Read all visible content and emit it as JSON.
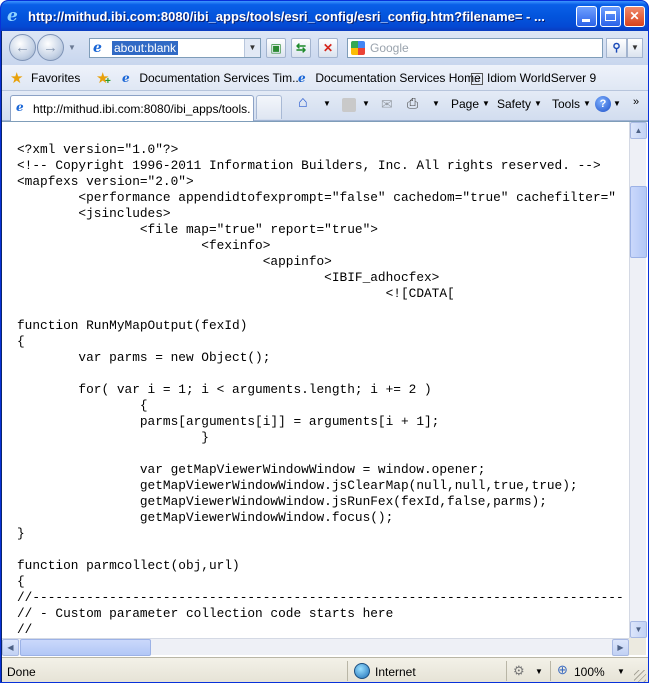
{
  "window": {
    "title": "http://mithud.ibi.com:8080/ibi_apps/tools/esri_config/esri_config.htm?filename= - ..."
  },
  "toolbar": {
    "address_value": "about:blank",
    "search_placeholder": "Google"
  },
  "favorites": {
    "label": "Favorites",
    "links": [
      "Documentation Services Tim...",
      "Documentation Services Home",
      "Idiom WorldServer 9"
    ]
  },
  "tab": {
    "title": "http://mithud.ibi.com:8080/ibi_apps/tools..."
  },
  "command_bar": {
    "page": "Page",
    "safety": "Safety",
    "tools": "Tools"
  },
  "content": {
    "lines": [
      "<?xml version=\"1.0\"?>",
      "<!-- Copyright 1996-2011 Information Builders, Inc. All rights reserved. -->",
      "<mapfexs version=\"2.0\">",
      "        <performance appendidtofexprompt=\"false\" cachedom=\"true\" cachefilter=\"",
      "        <jsincludes>",
      "                <file map=\"true\" report=\"true\">",
      "                        <fexinfo>",
      "                                <appinfo>",
      "                                        <IBIF_adhocfex>",
      "                                                <![CDATA[",
      "",
      "function RunMyMapOutput(fexId)",
      "{",
      "        var parms = new Object();",
      "",
      "        for( var i = 1; i < arguments.length; i += 2 )",
      "                {",
      "                parms[arguments[i]] = arguments[i + 1];",
      "                        }",
      "",
      "                var getMapViewerWindowWindow = window.opener;",
      "                getMapViewerWindowWindow.jsClearMap(null,null,true,true);",
      "                getMapViewerWindowWindow.jsRunFex(fexId,false,parms);",
      "                getMapViewerWindowWindow.focus();",
      "}",
      "",
      "function parmcollect(obj,url)",
      "{",
      "//-----------------------------------------------------------------------------",
      "// - Custom parameter collection code starts here",
      "//"
    ]
  },
  "status": {
    "text": "Done",
    "zone": "Internet",
    "zoom": "100%"
  }
}
